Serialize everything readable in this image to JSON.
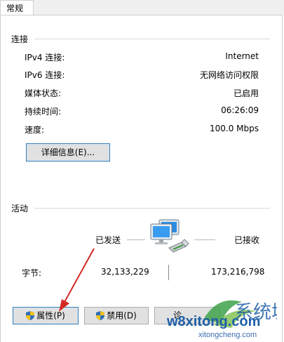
{
  "tab": {
    "label": "常规"
  },
  "connection": {
    "section_label": "连接",
    "rows": [
      {
        "key": "IPv4 连接:",
        "value": "Internet"
      },
      {
        "key": "IPv6 连接:",
        "value": "无网络访问权限"
      },
      {
        "key": "媒体状态:",
        "value": "已启用"
      },
      {
        "key": "持续时间:",
        "value": "06:26:09"
      },
      {
        "key": "速度:",
        "value": "100.0 Mbps"
      }
    ],
    "details_button": "详细信息(E)..."
  },
  "activity": {
    "section_label": "活动",
    "sent_label": "已发送",
    "received_label": "已接收",
    "bytes_label": "字节:",
    "bytes_sent": "32,133,229",
    "bytes_received": "173,216,798"
  },
  "buttons": {
    "properties": "属性(P)",
    "disable": "禁用(D)",
    "diagnose_partial": "诊"
  },
  "watermark": {
    "main": "w8xitong.com",
    "sub": "xitongcheng.com",
    "brand": "系统城"
  },
  "colors": {
    "arrow": "#d42a24",
    "focus": "#3c7fb1",
    "shield_blue": "#2f6fb8",
    "shield_yellow": "#f2c21b"
  }
}
